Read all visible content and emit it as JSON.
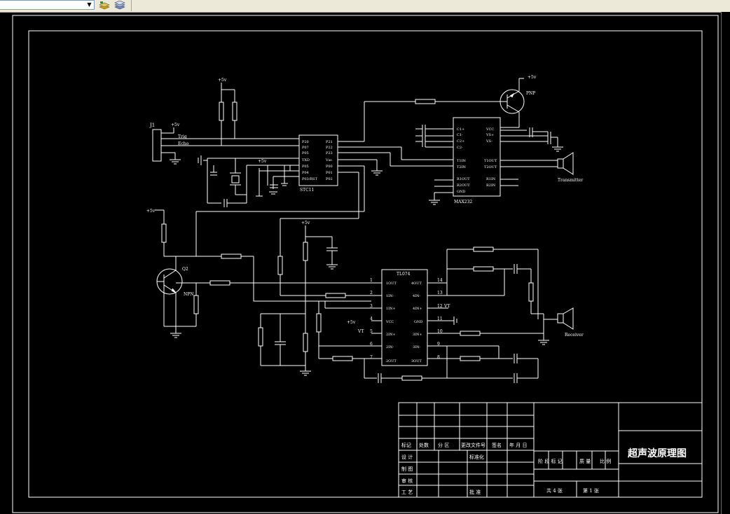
{
  "toolbar": {
    "layer_dropdown": {
      "value": ""
    },
    "icons": [
      "layer-stack-icon",
      "layer-properties-icon"
    ]
  },
  "drawing": {
    "components": {
      "j1": "J1",
      "stc": "STC11",
      "max": "MAX232",
      "tl": "TL074",
      "pnp": "PNP",
      "q2": "Q2",
      "npn": "NPN",
      "transmitter": "Transmitter",
      "receiver": "Receiver"
    },
    "power": {
      "vcc": "+5v"
    },
    "j1_pins": [
      "Trig",
      "Echo"
    ],
    "stc_left_pins": [
      "P20",
      "P07",
      "P05",
      "TXD",
      "P05",
      "P04",
      "P03/RST"
    ],
    "stc_right_pins": [
      "P21",
      "P22",
      "P23",
      "Vss",
      "P00",
      "P01",
      "P02"
    ],
    "max_left_pins": [
      "C1+",
      "C1-",
      "C2+",
      "C2-",
      "T1IN",
      "T2IN",
      "R1OUT",
      "R2OUT",
      "GND"
    ],
    "max_right_pins": [
      "VCC",
      "VS+",
      "VS-",
      "",
      "T1OUT",
      "T2OUT",
      "R1IN",
      "R2IN"
    ],
    "tl_left_pins": [
      "1OUT",
      "1IN-",
      "1IN+",
      "VCC",
      "2IN+",
      "2IN-",
      "2OUT"
    ],
    "tl_right_pins": [
      "4OUT",
      "4IN-",
      "4IN+",
      "GND",
      "3IN+",
      "3IN-",
      "3OUT"
    ],
    "tl_left_numbers": [
      "1",
      "2",
      "3",
      "4",
      "5",
      "6",
      "7"
    ],
    "tl_right_numbers": [
      "14",
      "13",
      "12",
      "11",
      "10",
      "9",
      "8"
    ],
    "net_labels": {
      "vt_right": "VT",
      "vt_left": "VT"
    }
  },
  "title_block": {
    "title": "超声波原理图",
    "header_cells": [
      "标记",
      "处数",
      "分 区",
      "更改文件号",
      "签名",
      "年 月 日"
    ],
    "row_labels": [
      "设 计",
      "制 图",
      "审 核",
      "工 艺"
    ],
    "standardize": "标准化",
    "approve": "批 准",
    "stage_labels": [
      "阶 段 标 记",
      "质 量",
      "比 例"
    ],
    "sheet_total": "共 4 张",
    "sheet_no": "第 1 张"
  }
}
